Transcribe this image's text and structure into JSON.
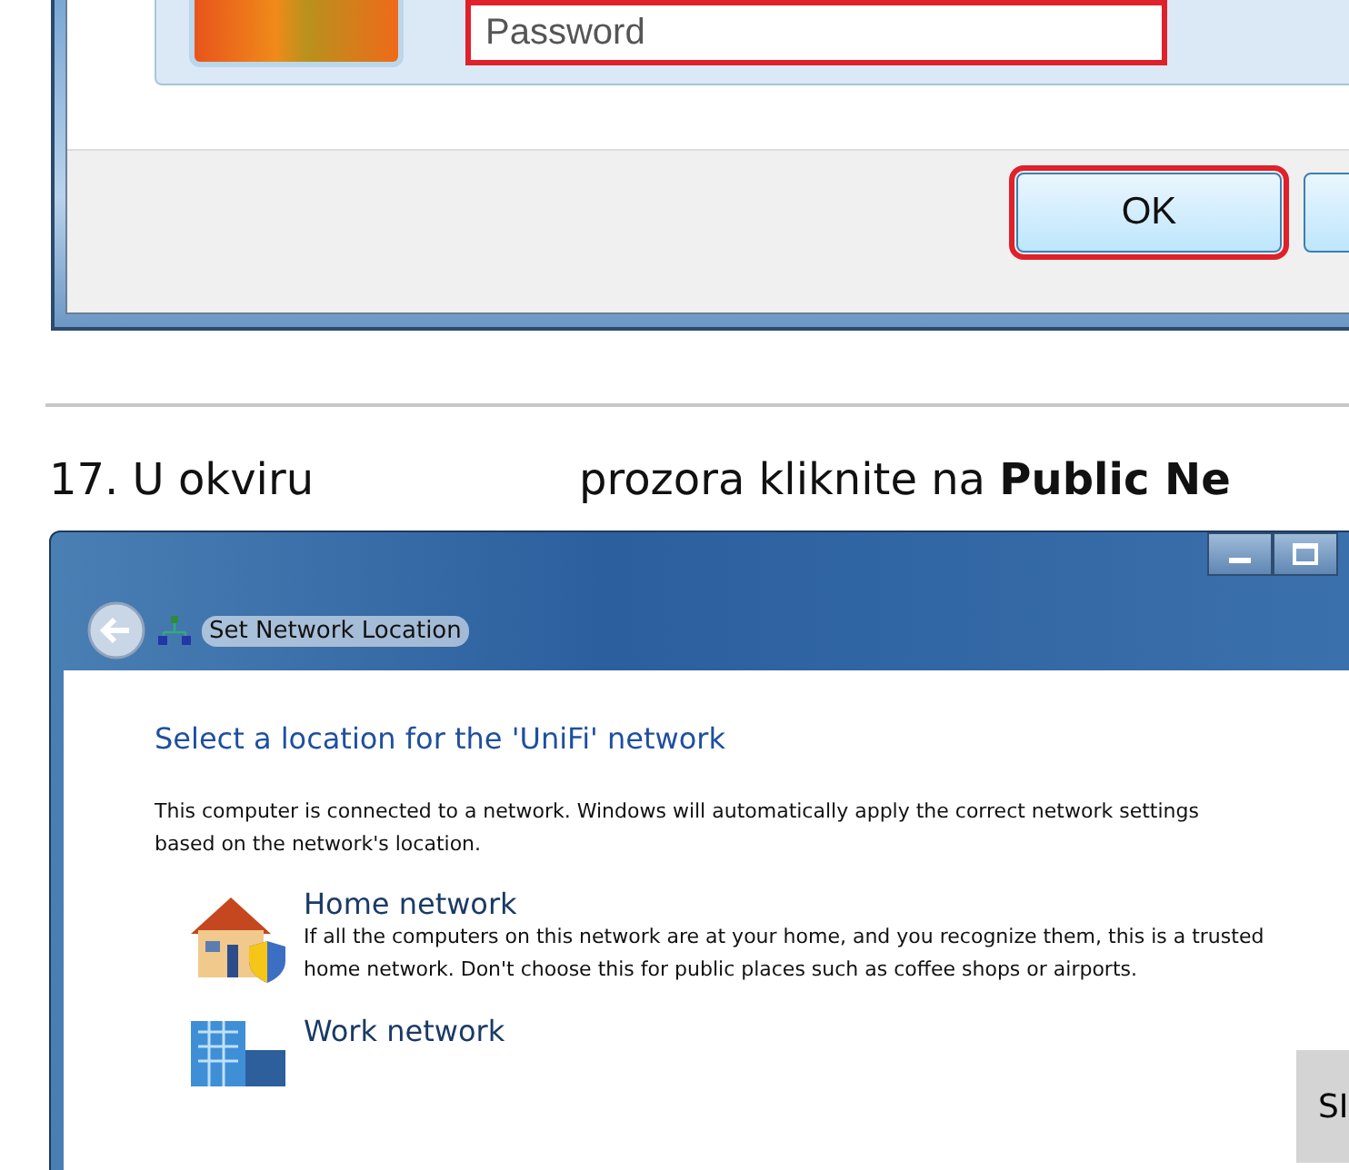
{
  "previous_dialog": {
    "password_field": {
      "placeholder": "Password",
      "highlighted": true
    },
    "buttons": [
      {
        "label": "OK",
        "highlighted": true
      },
      {
        "highlighted": false
      }
    ]
  },
  "step": {
    "lead": "17. U okviru",
    "text": "prozora kliknite na **Public Ne**"
  },
  "window": {
    "title": "Set Network Location",
    "heading": "Select a location for the 'UniFi' network",
    "intro": "This computer is connected to a network. Windows will automatically apply the correct network settings based on the network's location.",
    "options": [
      {
        "kind": "home",
        "title": "Home network",
        "description": "If all the computers on this network are at your home, and you recognize them, this is a trusted home network.  Don't choose this for public places such as coffee shops or airports."
      },
      {
        "kind": "work",
        "title": "Work network"
      }
    ]
  },
  "side_tab": {
    "label": "SI"
  }
}
